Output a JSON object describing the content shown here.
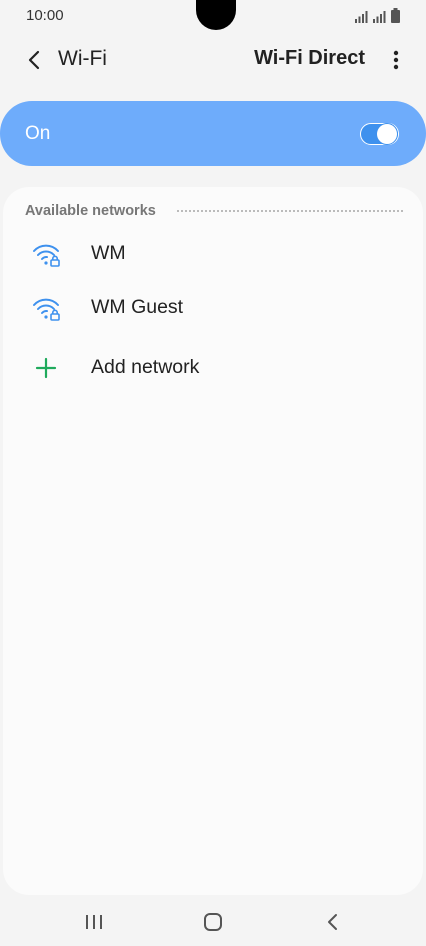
{
  "status_bar": {
    "time": "10:00"
  },
  "app_bar": {
    "title": "Wi-Fi",
    "action_label": "Wi-Fi Direct"
  },
  "master_switch": {
    "label": "On",
    "state": true
  },
  "networks": {
    "section_title": "Available networks",
    "items": [
      {
        "name": "WM",
        "icon": "wifi-lock-icon"
      },
      {
        "name": "WM Guest",
        "icon": "wifi-lock-icon"
      }
    ],
    "add_label": "Add network"
  },
  "colors": {
    "accent": "#3e91ee",
    "toggle_bar": "#6eacfb",
    "add_icon": "#1faa5c"
  }
}
